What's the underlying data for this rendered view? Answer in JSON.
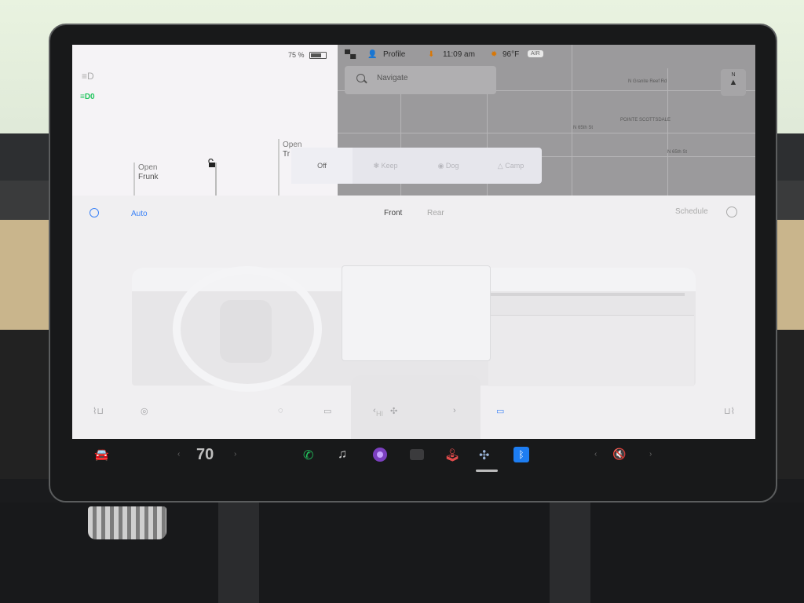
{
  "status": {
    "battery": "75 %",
    "profile_label": "Profile",
    "time": "11:09 am",
    "temperature": "96°F",
    "air_badge": "AIR"
  },
  "car_panel": {
    "frunk_action": "Open",
    "frunk_label": "Frunk",
    "trunk_action": "Open",
    "trunk_label": "Tr"
  },
  "map": {
    "search_placeholder": "Navigate",
    "compass_label": "N",
    "labels": [
      "N Granite Reef Rd",
      "POINTE SCOTTSDALE",
      "N 65th St",
      "N 65th St"
    ]
  },
  "sentry": {
    "options": [
      "Off",
      "Keep",
      "Dog",
      "Camp"
    ],
    "active": "Off"
  },
  "climate": {
    "auto_label": "Auto",
    "tab_front": "Front",
    "tab_rear": "Rear",
    "schedule_label": "Schedule",
    "fan_speed": "HI"
  },
  "taskbar": {
    "cabin_temp": "70"
  },
  "colors": {
    "accent_blue": "#3b82f6",
    "phone_green": "#22c55e",
    "bluetooth_blue": "#1d7df2"
  }
}
